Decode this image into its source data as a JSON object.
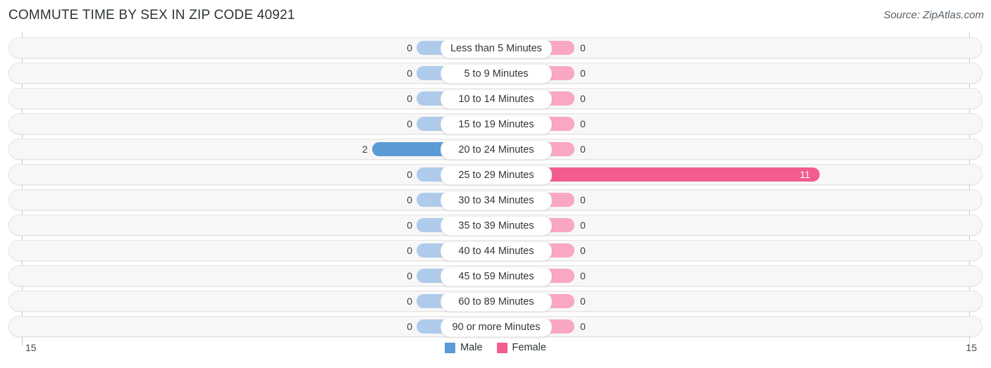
{
  "header": {
    "title": "COMMUTE TIME BY SEX IN ZIP CODE 40921",
    "source": "Source: ZipAtlas.com"
  },
  "footer": {
    "axis_left": "15",
    "axis_right": "15",
    "legend": [
      {
        "label": "Male",
        "color": "#5b9bd5",
        "swatch_name": "legend-swatch-male"
      },
      {
        "label": "Female",
        "color": "#f25d8e",
        "swatch_name": "legend-swatch-female"
      }
    ]
  },
  "chart_data": {
    "type": "bar",
    "subtype": "diverging-horizontal-butterfly",
    "title": "COMMUTE TIME BY SEX IN ZIP CODE 40921",
    "xlabel": "",
    "ylabel": "",
    "axis_max": 15,
    "xlim": [
      -15,
      15
    ],
    "grid": false,
    "legend_position": "bottom-center",
    "categories": [
      "Less than 5 Minutes",
      "5 to 9 Minutes",
      "10 to 14 Minutes",
      "15 to 19 Minutes",
      "20 to 24 Minutes",
      "25 to 29 Minutes",
      "30 to 34 Minutes",
      "35 to 39 Minutes",
      "40 to 44 Minutes",
      "45 to 59 Minutes",
      "60 to 89 Minutes",
      "90 or more Minutes"
    ],
    "series": [
      {
        "name": "Male",
        "direction": "left",
        "color": "#5b9bd5",
        "zero_color": "#aecbeb",
        "values": [
          0,
          0,
          0,
          0,
          2,
          0,
          0,
          0,
          0,
          0,
          0,
          0
        ],
        "labels": [
          "0",
          "0",
          "0",
          "0",
          "2",
          "0",
          "0",
          "0",
          "0",
          "0",
          "0",
          "0"
        ]
      },
      {
        "name": "Female",
        "direction": "right",
        "color": "#f25d8e",
        "zero_color": "#f9a7c4",
        "values": [
          0,
          0,
          0,
          0,
          0,
          11,
          0,
          0,
          0,
          0,
          0,
          0
        ],
        "labels": [
          "0",
          "0",
          "0",
          "0",
          "0",
          "11",
          "0",
          "0",
          "0",
          "0",
          "0",
          "0"
        ]
      }
    ]
  }
}
